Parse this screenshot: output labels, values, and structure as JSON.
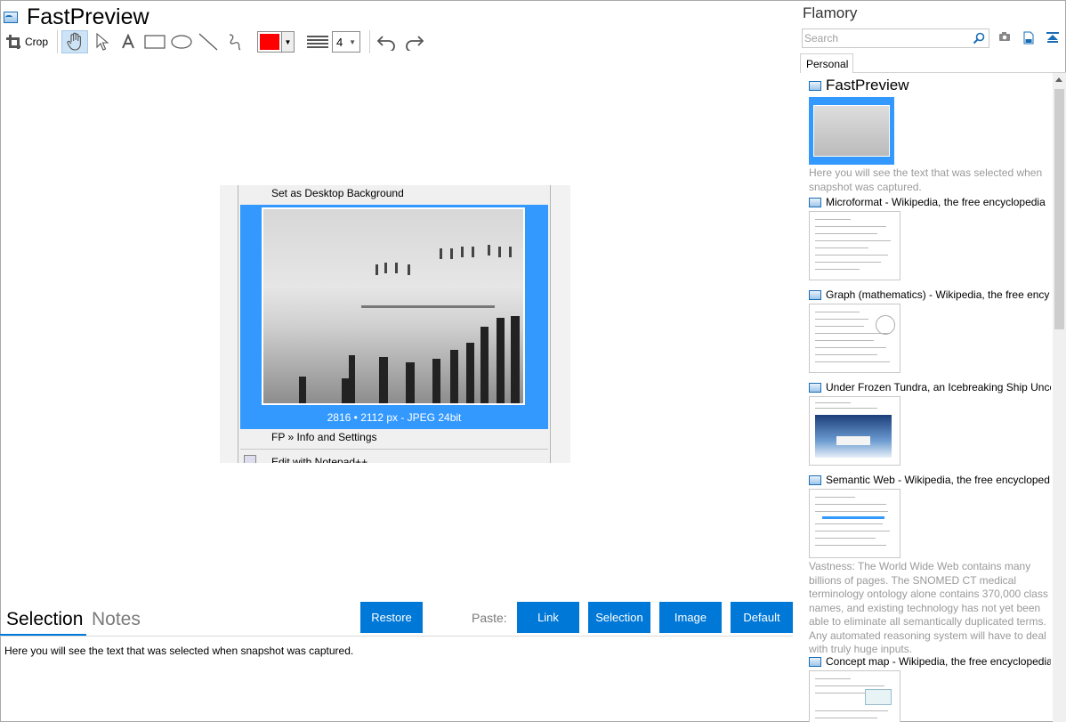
{
  "app": {
    "title": "FastPreview",
    "icon": "fastpreview-app-icon"
  },
  "toolbar": {
    "crop_label": "Crop",
    "tools": [
      {
        "name": "pan-hand-icon",
        "active": true
      },
      {
        "name": "select-arrow-icon",
        "active": false
      },
      {
        "name": "text-tool-icon",
        "active": false
      },
      {
        "name": "rectangle-tool-icon",
        "active": false
      },
      {
        "name": "ellipse-tool-icon",
        "active": false
      },
      {
        "name": "line-tool-icon",
        "active": false
      },
      {
        "name": "freehand-tool-icon",
        "active": false
      }
    ],
    "color": "#ff0000",
    "line_width": "4",
    "undo_icon": "undo-icon",
    "redo_icon": "redo-icon"
  },
  "preview": {
    "menu_item_top": "Set as Desktop Background",
    "image_caption": "2816 • 2112 px - JPEG 24bit",
    "menu_item_info": "FP » Info and Settings",
    "menu_item_edit": "Edit with Notepad++",
    "selection_color": "#3399ff"
  },
  "bottom": {
    "tabs": [
      {
        "label": "Selection",
        "active": true
      },
      {
        "label": "Notes",
        "active": false
      }
    ],
    "restore_label": "Restore",
    "paste_label": "Paste:",
    "paste_buttons": [
      "Link",
      "Selection",
      "Image",
      "Default"
    ],
    "selection_text": "Here you will see the text that was selected when snapshot was captured.",
    "accent": "#0078d7"
  },
  "flamory": {
    "title": "Flamory",
    "search_placeholder": "Search",
    "tab_label": "Personal",
    "icons": [
      "search-icon",
      "camera-icon",
      "document-icon",
      "collapse-top-icon"
    ],
    "items": [
      {
        "title": "FastPreview",
        "big": true,
        "desc": "Here you will see the text that was selected when snapshot was captured."
      },
      {
        "title": "Microformat - Wikipedia, the free encyclopedia",
        "big": false,
        "desc": ""
      },
      {
        "title": "Graph (mathematics) - Wikipedia, the free ency",
        "big": false,
        "desc": ""
      },
      {
        "title": "Under Frozen Tundra, an Icebreaking Ship Unco",
        "big": false,
        "desc": ""
      },
      {
        "title": "Semantic Web - Wikipedia, the free encycloped",
        "big": false,
        "desc": "Vastness: The World Wide Web contains many billions of pages. The SNOMED CT medical terminology ontology alone contains 370,000 class names, and existing technology has not yet been able to eliminate all semantically duplicated terms. Any automated reasoning system will have to deal with truly huge inputs."
      },
      {
        "title": "Concept map - Wikipedia, the free encyclopedia",
        "big": false,
        "desc": ""
      }
    ]
  }
}
